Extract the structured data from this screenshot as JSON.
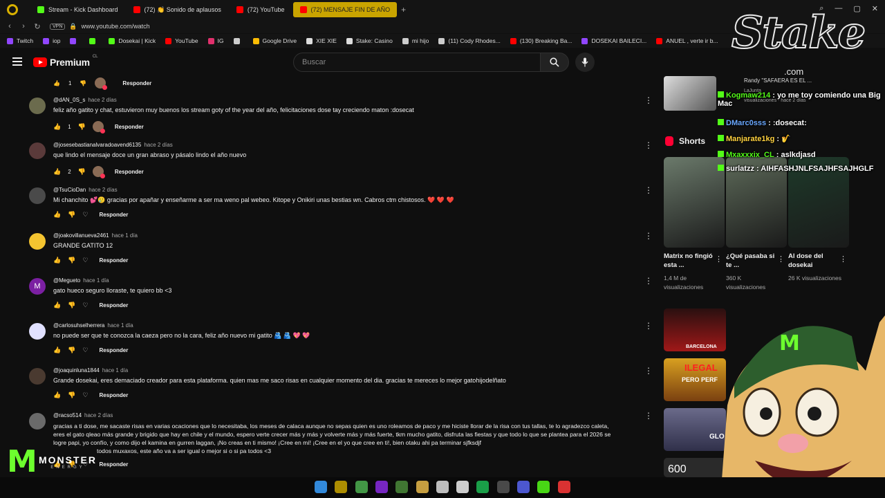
{
  "browser": {
    "tabs": [
      {
        "label": "Stream - Kick Dashboard",
        "color": "#53fc18",
        "active": false
      },
      {
        "label": "(72) 👏 Sonido de aplausos",
        "color": "#ff0000",
        "active": false
      },
      {
        "label": "(72) YouTube",
        "color": "#ff0000",
        "active": false
      },
      {
        "label": "(72) MENSAJE FIN DE AÑO",
        "color": "#ff0000",
        "active": true
      }
    ],
    "new_tab": "+",
    "vpn_label": "VPN",
    "url": "www.youtube.com/watch",
    "bookmarks": [
      {
        "label": "Twitch",
        "color": "#9146ff"
      },
      {
        "label": "iop",
        "color": "#9146ff"
      },
      {
        "label": "",
        "color": "#9146ff"
      },
      {
        "label": "",
        "color": "#53fc18"
      },
      {
        "label": "Dosekai | Kick",
        "color": "#53fc18"
      },
      {
        "label": "YouTube",
        "color": "#ff0000"
      },
      {
        "label": "IG",
        "color": "#e1306c"
      },
      {
        "label": "",
        "color": "#cccccc"
      },
      {
        "label": "Google Drive",
        "color": "#fbbc04"
      },
      {
        "label": "XIE XIE",
        "color": "#dddddd"
      },
      {
        "label": "Stake: Casino",
        "color": "#dddddd"
      },
      {
        "label": "mi hijo",
        "color": "#cccccc"
      },
      {
        "label": "(11) Cody Rhodes...",
        "color": "#cccccc"
      },
      {
        "label": "(130) Breaking Ba...",
        "color": "#ff0000"
      },
      {
        "label": "DOSEKAI BAILECI...",
        "color": "#9146ff"
      },
      {
        "label": "ANUEL , verte ir b...",
        "color": "#ff0000"
      }
    ]
  },
  "youtube": {
    "logo_text": "Premium",
    "region": "CL",
    "search_placeholder": "Buscar",
    "top_reply": {
      "likes": "1",
      "reply_label": "Responder"
    }
  },
  "comments": [
    {
      "user": "@dAN_0S_s",
      "when": "hace 2 días",
      "text": "feliz año gatito y chat, estuvieron muy buenos los stream goty of the year del año, felicitaciones dose tay creciendo maton :dosecat",
      "likes": "1",
      "reply": "Responder",
      "creator_heart": true,
      "avatar_color": "#6b6b4d"
    },
    {
      "user": "@josesebastianalvaradoavend6135",
      "when": "hace 2 días",
      "text": "que lindo el mensaje doce un gran abraso y pásalo lindo el año nuevo",
      "likes": "2",
      "reply": "Responder",
      "creator_heart": true,
      "avatar_color": "#5a3a3a"
    },
    {
      "user": "@TsuCioDan",
      "when": "hace 2 días",
      "text": "Mi chanchito 💕🥲 gracias por apañar y enseñarme a ser ma weno pal webeo. Kitope y Onikiri unas bestias wn. Cabros ctm chistosos. ❤️ ❤️ ❤️",
      "likes": "",
      "reply": "Responder",
      "creator_heart": false,
      "avatar_color": "#4a4a4a"
    },
    {
      "user": "@joakovillanueva2461",
      "when": "hace 1 día",
      "text": "GRANDE GATITO 12",
      "likes": "",
      "reply": "Responder",
      "creator_heart": false,
      "avatar_color": "#f4c430"
    },
    {
      "user": "@Megueto",
      "when": "hace 1 día",
      "text": "gato hueco seguro lloraste, te quiero bb <3",
      "likes": "",
      "reply": "Responder",
      "creator_heart": false,
      "avatar_color": "#7b1fa2",
      "avatar_letter": "M"
    },
    {
      "user": "@carlosuhselherrera",
      "when": "hace 1 día",
      "text": "no puede ser que te conozca la caeza pero no la cara, feliz año nuevo mi gatito 🫂 🫂 💖 💖",
      "likes": "",
      "reply": "Responder",
      "creator_heart": false,
      "avatar_color": "#e0e0ff"
    },
    {
      "user": "@joaquinluna1844",
      "when": "hace 1 día",
      "text": "Grande dosekai, eres demaciado creador para esta plataforma. quien mas me saco risas en cualquier momento del dia. gracias te mereces lo mejor gatohijodelñato",
      "likes": "",
      "reply": "Responder",
      "creator_heart": false,
      "avatar_color": "#4a3a30"
    },
    {
      "user": "@racso514",
      "when": "hace 2 días",
      "lines": [
        "gracias a ti dose, me sacaste risas en varias ocaciones que lo necesitaba, los meses de calaca aunque no sepas quien es uno roleamos de paco y me hiciste llorar de la risa con tus tallas, te lo agradezco caleta,",
        "eres el gato qleao más grande y brigido que hay en chile y el mundo, espero verte crecer más y más y volverte más y más fuerte, tkm mucho gatito, disfruta las fiestas y que todo lo que se plantea para el 2026 se",
        "logre papi, yo confío, y como dijo el kamina en gurren laggan, ¡No creas en ti mismo! ¡Cree en mí! ¡Cree en el yo que cree en ti!, bien otaku ahi pa terminar sjfksdjf",
        "todos muxaxos, este año va a ser igual o mejor si o si pa todos <3"
      ],
      "likes": "",
      "reply": "Responder",
      "creator_heart": false,
      "avatar_color": "#6a6a6a"
    }
  ],
  "sidebar": {
    "related_snippet": {
      "title": "Randy \"SAFAERA ES EL ...",
      "channel": "LaJunta",
      "meta": "visualizaciones · hace 2 días"
    },
    "shorts_label": "Shorts",
    "shorts": [
      {
        "title": "Matrix no fingió esta ...",
        "views": "1,4 M de visualizaciones",
        "color": "#6b7a6b"
      },
      {
        "title": "¿Qué pasaba si te ...",
        "views": "360 K visualizaciones",
        "color": "#5e6b5a"
      },
      {
        "title": "Al dose del dosekai",
        "views": "26 K visualizaciones",
        "color": "#1e3a2a"
      }
    ],
    "video_labels": [
      "BARCELONA",
      "ILEGAL",
      "PERO PERF",
      "GLO",
      "600"
    ]
  },
  "stream_overlay": {
    "sponsor_logo": "Stake",
    "sponsor_domain": ".com",
    "chat": [
      {
        "user": "Kogmaw214",
        "msg": "yo me toy comiendo una Big Mac",
        "color": "#53fc18"
      },
      {
        "user": "DMarc0sss",
        "msg": ":dosecat:",
        "color": "#6aa8ff"
      },
      {
        "user": "Manjarate1kg",
        "msg": "🎷",
        "color": "#ffd23f"
      },
      {
        "user": "Mxaxxxix_CL",
        "msg": "aslkdjasd",
        "color": "#53fc18"
      },
      {
        "user": "surlatzz",
        "msg": "AIHFASHJNLFSAJHFSAJHGLF",
        "color": "#ffffff"
      }
    ],
    "sponsor2_word": "MONSTER",
    "sponsor2_sub": "ENERGY"
  },
  "taskbar": {
    "icons": [
      "windows-start-icon",
      "opera-gx-icon",
      "chrome-icon",
      "vegas-icon",
      "notepad-icon",
      "file-explorer-icon",
      "obs-icon",
      "capcut-icon",
      "spotify-icon",
      "steam-icon",
      "discord-icon",
      "kick-app-icon",
      "extra-app-icon"
    ]
  }
}
